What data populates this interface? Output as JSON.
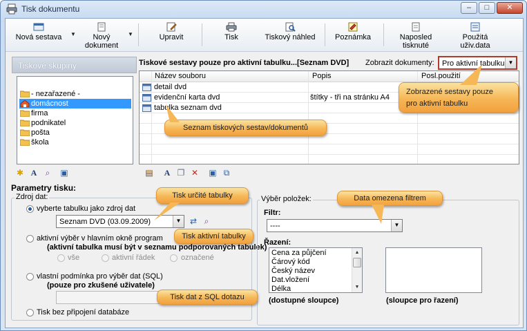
{
  "window": {
    "title": "Tisk dokumentu",
    "btn_min": "–",
    "btn_max": "□",
    "btn_close": "✕"
  },
  "toolbar": {
    "new_set": "Nová sestava",
    "new_doc_l1": "Nový",
    "new_doc_l2": "dokument",
    "edit": "Upravit",
    "print": "Tisk",
    "preview": "Tiskový náhled",
    "note": "Poznámka",
    "last_l1": "Naposled",
    "last_l2": "tisknuté",
    "used_l1": "Použitá",
    "used_l2": "uživ.data"
  },
  "groups": {
    "header": "Tiskové skupiny",
    "items": [
      {
        "label": "- nezařazené -"
      },
      {
        "label": "domácnost"
      },
      {
        "label": "firma"
      },
      {
        "label": "podnikatel"
      },
      {
        "label": "pošta"
      },
      {
        "label": "škola"
      }
    ],
    "selected": "domácnost"
  },
  "reports": {
    "title": "Tiskové sestavy pouze pro aktivní tabulku...[Seznam DVD]",
    "show_label": "Zobrazit dokumenty:",
    "show_value": "Pro aktivní tabulku",
    "columns": [
      "Název souboru",
      "Popis",
      "Posl.použití"
    ],
    "rows": [
      {
        "name": "detail dvd",
        "desc": "",
        "last": ""
      },
      {
        "name": "evidenční karta dvd",
        "desc": "štítky - tři na stránku A4",
        "last": ""
      },
      {
        "name": "tabulka seznam dvd",
        "desc": "",
        "last": ""
      }
    ]
  },
  "params": {
    "title": "Parametry tisku:",
    "source_group": "Zdroj dat:",
    "opt_table": "vyberte tabulku jako zdroj dat",
    "table_value": "Seznam DVD (03.09.2009)",
    "opt_active": "aktivní výběr v hlavním okně program",
    "active_note": "(aktivní tabulka musí být v seznamu podporovaných tabulek)",
    "sub_all": "vše",
    "sub_row": "aktivní řádek",
    "sub_marked": "označené",
    "opt_sql": "vlastní podmínka pro výběr dat (SQL)",
    "sql_note": "(pouze pro zkušené uživatele)",
    "sql_value": "",
    "opt_nodb": "Tisk bez připojení databáze"
  },
  "selection": {
    "group": "Výběr položek:",
    "filter_label": "Filtr:",
    "filter_value": "----",
    "sort_label": "Řazení:",
    "available": [
      "Cena za půjčení",
      "Čárový kód",
      "Český název",
      "Dat.vložení",
      "Délka"
    ],
    "available_caption": "(dostupné sloupce)",
    "sort_caption": "(sloupce pro řazení)"
  },
  "callouts": {
    "shown_l1": "Zobrazené sestavy pouze",
    "shown_l2": "pro aktivní tabulku",
    "list": "Seznam tiskových sestav/dokumentů",
    "table": "Tisk určité tabulky",
    "active": "Tisk aktivní tabulky",
    "filter": "Data omezena filtrem",
    "sql": "Tisk dat z SQL dotazu"
  },
  "colors": {
    "accent": "#3399ff",
    "callout": "#f6b757",
    "highlight_border": "#b23a2b"
  }
}
